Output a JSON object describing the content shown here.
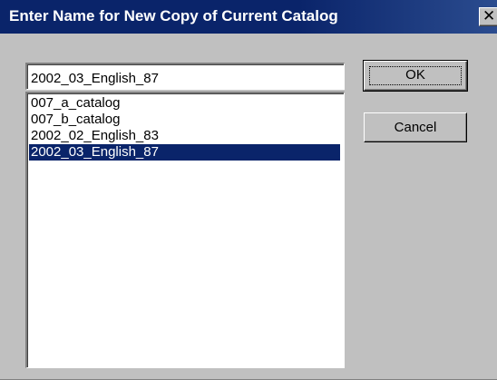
{
  "window": {
    "title": "Enter Name for New Copy of Current Catalog",
    "close_glyph": "✕",
    "close_icon": "close-icon",
    "title_bar_color": "#0a246a",
    "background_color": "#c0c0c0"
  },
  "name_input": {
    "value": "2002_03_English_87"
  },
  "catalog_list": {
    "items": [
      {
        "label": "007_a_catalog",
        "selected": false
      },
      {
        "label": "007_b_catalog",
        "selected": false
      },
      {
        "label": "2002_02_English_83",
        "selected": false
      },
      {
        "label": "2002_03_English_87",
        "selected": true
      }
    ],
    "selection_color": "#0a246a"
  },
  "buttons": {
    "ok_label": "OK",
    "cancel_label": "Cancel"
  }
}
